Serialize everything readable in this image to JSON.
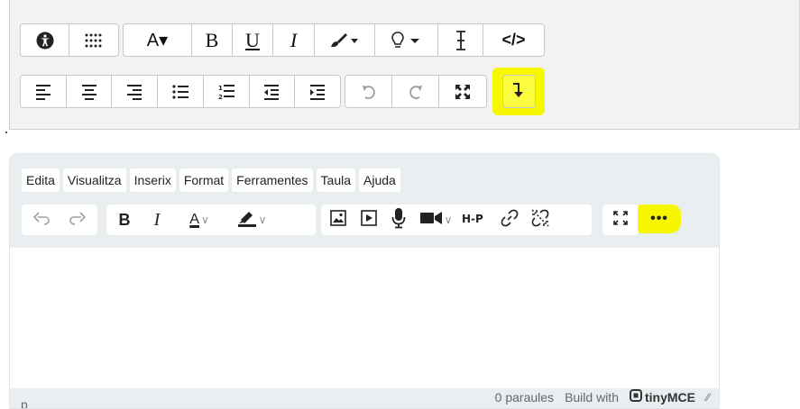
{
  "atto_toolbar": {
    "row1": [
      {
        "icon": "accessibility-icon"
      },
      {
        "icon": "apps-grid-icon"
      },
      {
        "icon": "font-color-icon",
        "label": "A▾"
      },
      {
        "icon": "bold-icon",
        "label": "B"
      },
      {
        "icon": "underline-icon",
        "label": "U"
      },
      {
        "icon": "italic-icon",
        "label": "I"
      },
      {
        "icon": "paint-brush-icon"
      },
      {
        "icon": "lightbulb-icon"
      },
      {
        "icon": "text-cursor-icon"
      },
      {
        "icon": "code-icon",
        "label": "</>"
      }
    ],
    "row2": [
      {
        "icon": "align-left-icon"
      },
      {
        "icon": "align-center-icon"
      },
      {
        "icon": "align-right-icon"
      },
      {
        "icon": "bullet-list-icon"
      },
      {
        "icon": "numbered-list-icon"
      },
      {
        "icon": "outdent-icon"
      },
      {
        "icon": "indent-icon"
      },
      {
        "icon": "undo-icon"
      },
      {
        "icon": "redo-icon"
      },
      {
        "icon": "fullscreen-icon"
      },
      {
        "icon": "collapse-toolbar-arrow-icon",
        "highlighted": true
      }
    ],
    "highlight_color": "#f7f700"
  },
  "tinymce": {
    "menubar": [
      "Edita",
      "Visualitza",
      "Inserix",
      "Format",
      "Ferramentes",
      "Taula",
      "Ajuda"
    ],
    "toolbar": {
      "undo": "undo-icon",
      "redo": "redo-icon",
      "bold_label": "B",
      "italic_label": "I",
      "text_color_label": "A",
      "more_label": "•••"
    },
    "status": {
      "path": "p",
      "word_count": "0 paraules",
      "build_with": "Build with",
      "brand": "tinyMCE"
    },
    "header_bg": "#e9eef0"
  }
}
